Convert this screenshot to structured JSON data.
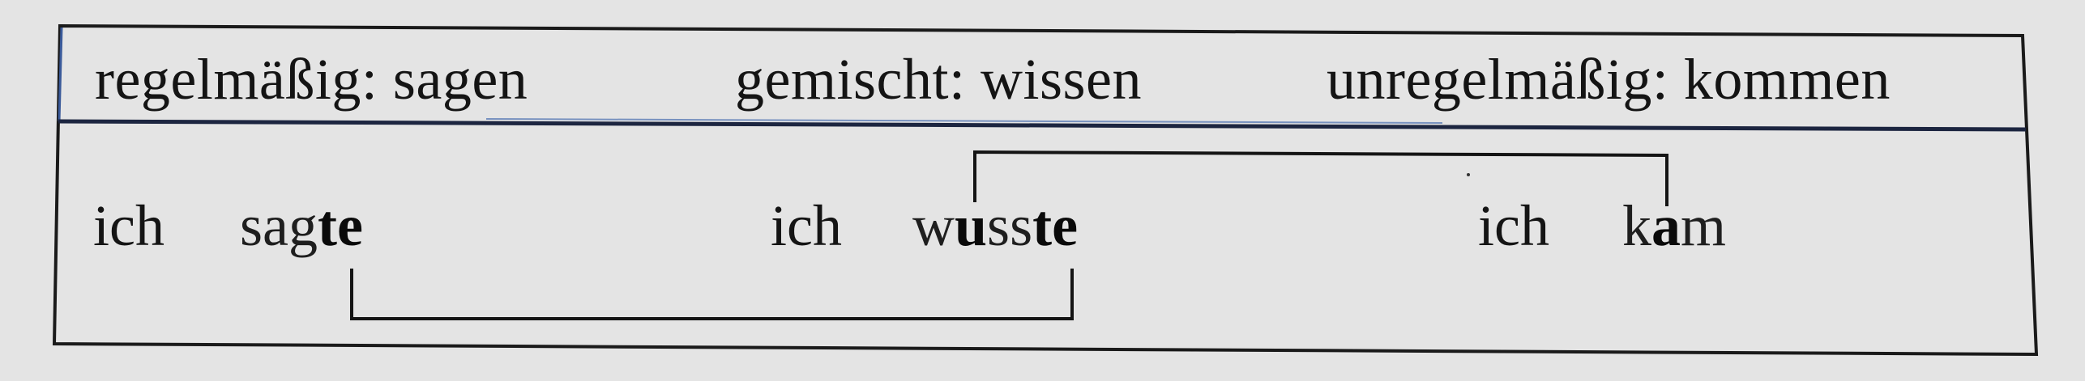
{
  "header": {
    "regular": "regelmäßig: sagen",
    "mixed": "gemischt: wissen",
    "irregular": "unregelmäßig: kommen"
  },
  "forms": {
    "regular": {
      "pronoun": "ich",
      "stem": "sag",
      "ending": "te"
    },
    "mixed": {
      "pronoun": "ich",
      "start": "w",
      "vowel": "u",
      "middle": "ss",
      "ending": "te"
    },
    "irregular": {
      "pronoun": "ich",
      "start": "k",
      "vowel": "a",
      "end": "m"
    }
  },
  "colors": {
    "background": "#e4e4e4",
    "border": "#1a1a1a",
    "header_rule": "#3a5a9a",
    "text": "#141414"
  }
}
